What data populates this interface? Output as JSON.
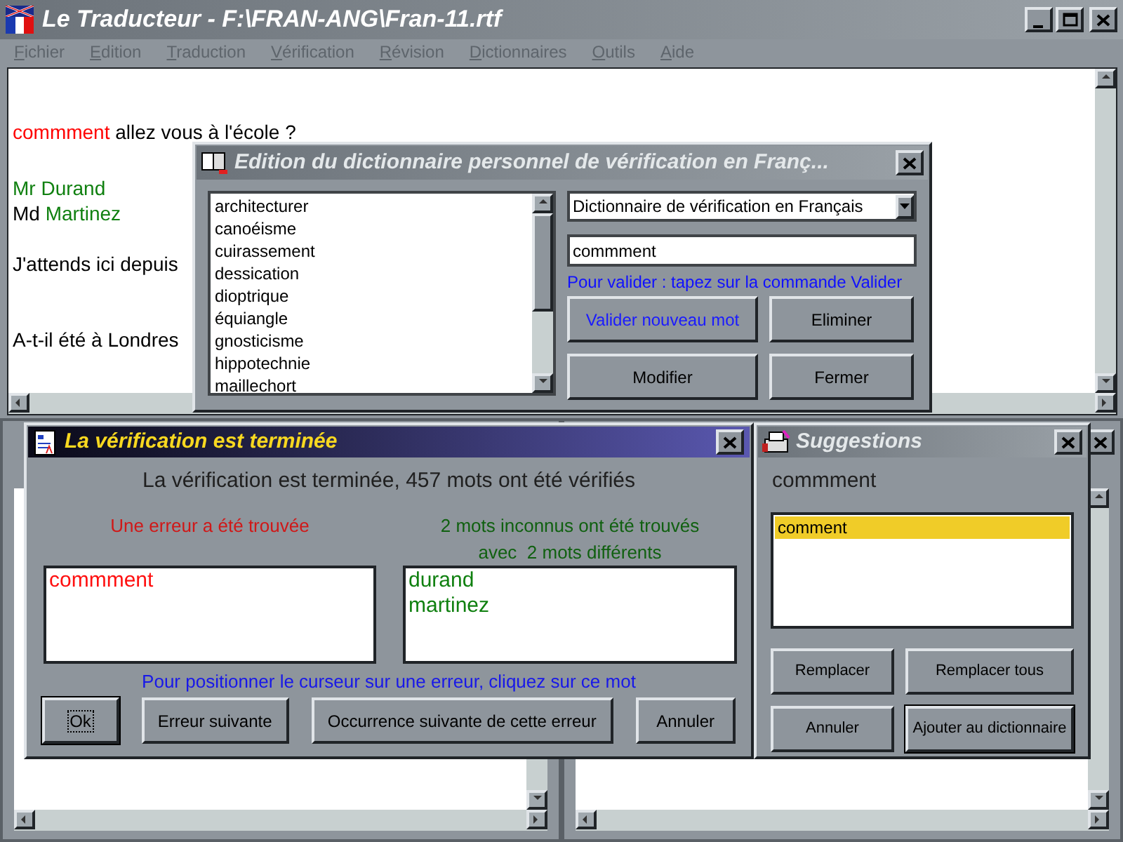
{
  "window": {
    "title": "Le Traducteur - F:\\FRAN-ANG\\Fran-11.rtf"
  },
  "menu": [
    {
      "label": "Fichier",
      "disabled": true
    },
    {
      "label": "Edition",
      "disabled": true
    },
    {
      "label": "Traduction",
      "disabled": true
    },
    {
      "label": "Vérification",
      "disabled": true
    },
    {
      "label": "Révision",
      "disabled": true
    },
    {
      "label": "Dictionnaires",
      "disabled": true
    },
    {
      "label": "Outils",
      "disabled": true
    },
    {
      "label": "Aide",
      "disabled": true
    }
  ],
  "document": {
    "lines": [
      {
        "segments": [
          {
            "text": "commment",
            "kind": "error"
          },
          {
            "text": " allez vous à l'école ?",
            "kind": "normal"
          }
        ]
      },
      {
        "segments": [
          {
            "text": "Mr Durand",
            "kind": "unknown"
          }
        ]
      },
      {
        "segments": [
          {
            "text": "Md ",
            "kind": "normal"
          },
          {
            "text": "Martinez",
            "kind": "unknown"
          }
        ]
      },
      {
        "segments": [
          {
            "text": "J'attends ici depuis",
            "kind": "normal"
          }
        ]
      },
      {
        "segments": [
          {
            "text": "A-t-il été à Londres",
            "kind": "normal"
          }
        ]
      }
    ]
  },
  "dictionary_dialog": {
    "title": "Edition du dictionnaire personnel de vérification en Franç...",
    "words": [
      "architecturer",
      "canoéisme",
      "cuirassement",
      "dessication",
      "dioptrique",
      "équiangle",
      "gnosticisme",
      "hippotechnie",
      "maillechort"
    ],
    "dictionary": "Dictionnaire de vérification en Français",
    "word_value": "commment",
    "hint": "Pour valider : tapez sur la commande Valider",
    "buttons": [
      {
        "label": "Valider nouveau mot",
        "highlighted": true
      },
      {
        "label": "Eliminer",
        "highlighted": false
      },
      {
        "label": "Modifier",
        "highlighted": false
      },
      {
        "label": "Fermer",
        "highlighted": false
      }
    ]
  },
  "verification_dialog": {
    "title": "La vérification est terminée",
    "summary": "La vérification est terminée, 457 mots ont été vérifiés",
    "errors_label": "Une erreur a été trouvée",
    "unknown_label": [
      "2 mots inconnus ont été trouvés",
      "avec  2 mots différents"
    ],
    "errors": [
      "commment"
    ],
    "unknown_words": [
      "durand",
      "martinez"
    ],
    "hint": "Pour positionner le curseur sur une erreur, cliquez sur ce mot",
    "buttons": [
      {
        "label": "Ok",
        "focused": true
      },
      {
        "label": "Erreur suivante",
        "focused": false
      },
      {
        "label": "Occurrence suivante de cette erreur",
        "focused": false
      },
      {
        "label": "Annuler",
        "focused": false
      }
    ]
  },
  "suggestions_dialog": {
    "title": "Suggestions",
    "word": "commment",
    "suggestions": [
      {
        "text": "comment",
        "selected": true
      }
    ],
    "buttons": [
      {
        "label": "Remplacer",
        "default": false
      },
      {
        "label": "Remplacer tous",
        "default": false
      },
      {
        "label": "Annuler",
        "default": false
      },
      {
        "label": "Ajouter au dictionnaire",
        "default": true
      }
    ]
  }
}
